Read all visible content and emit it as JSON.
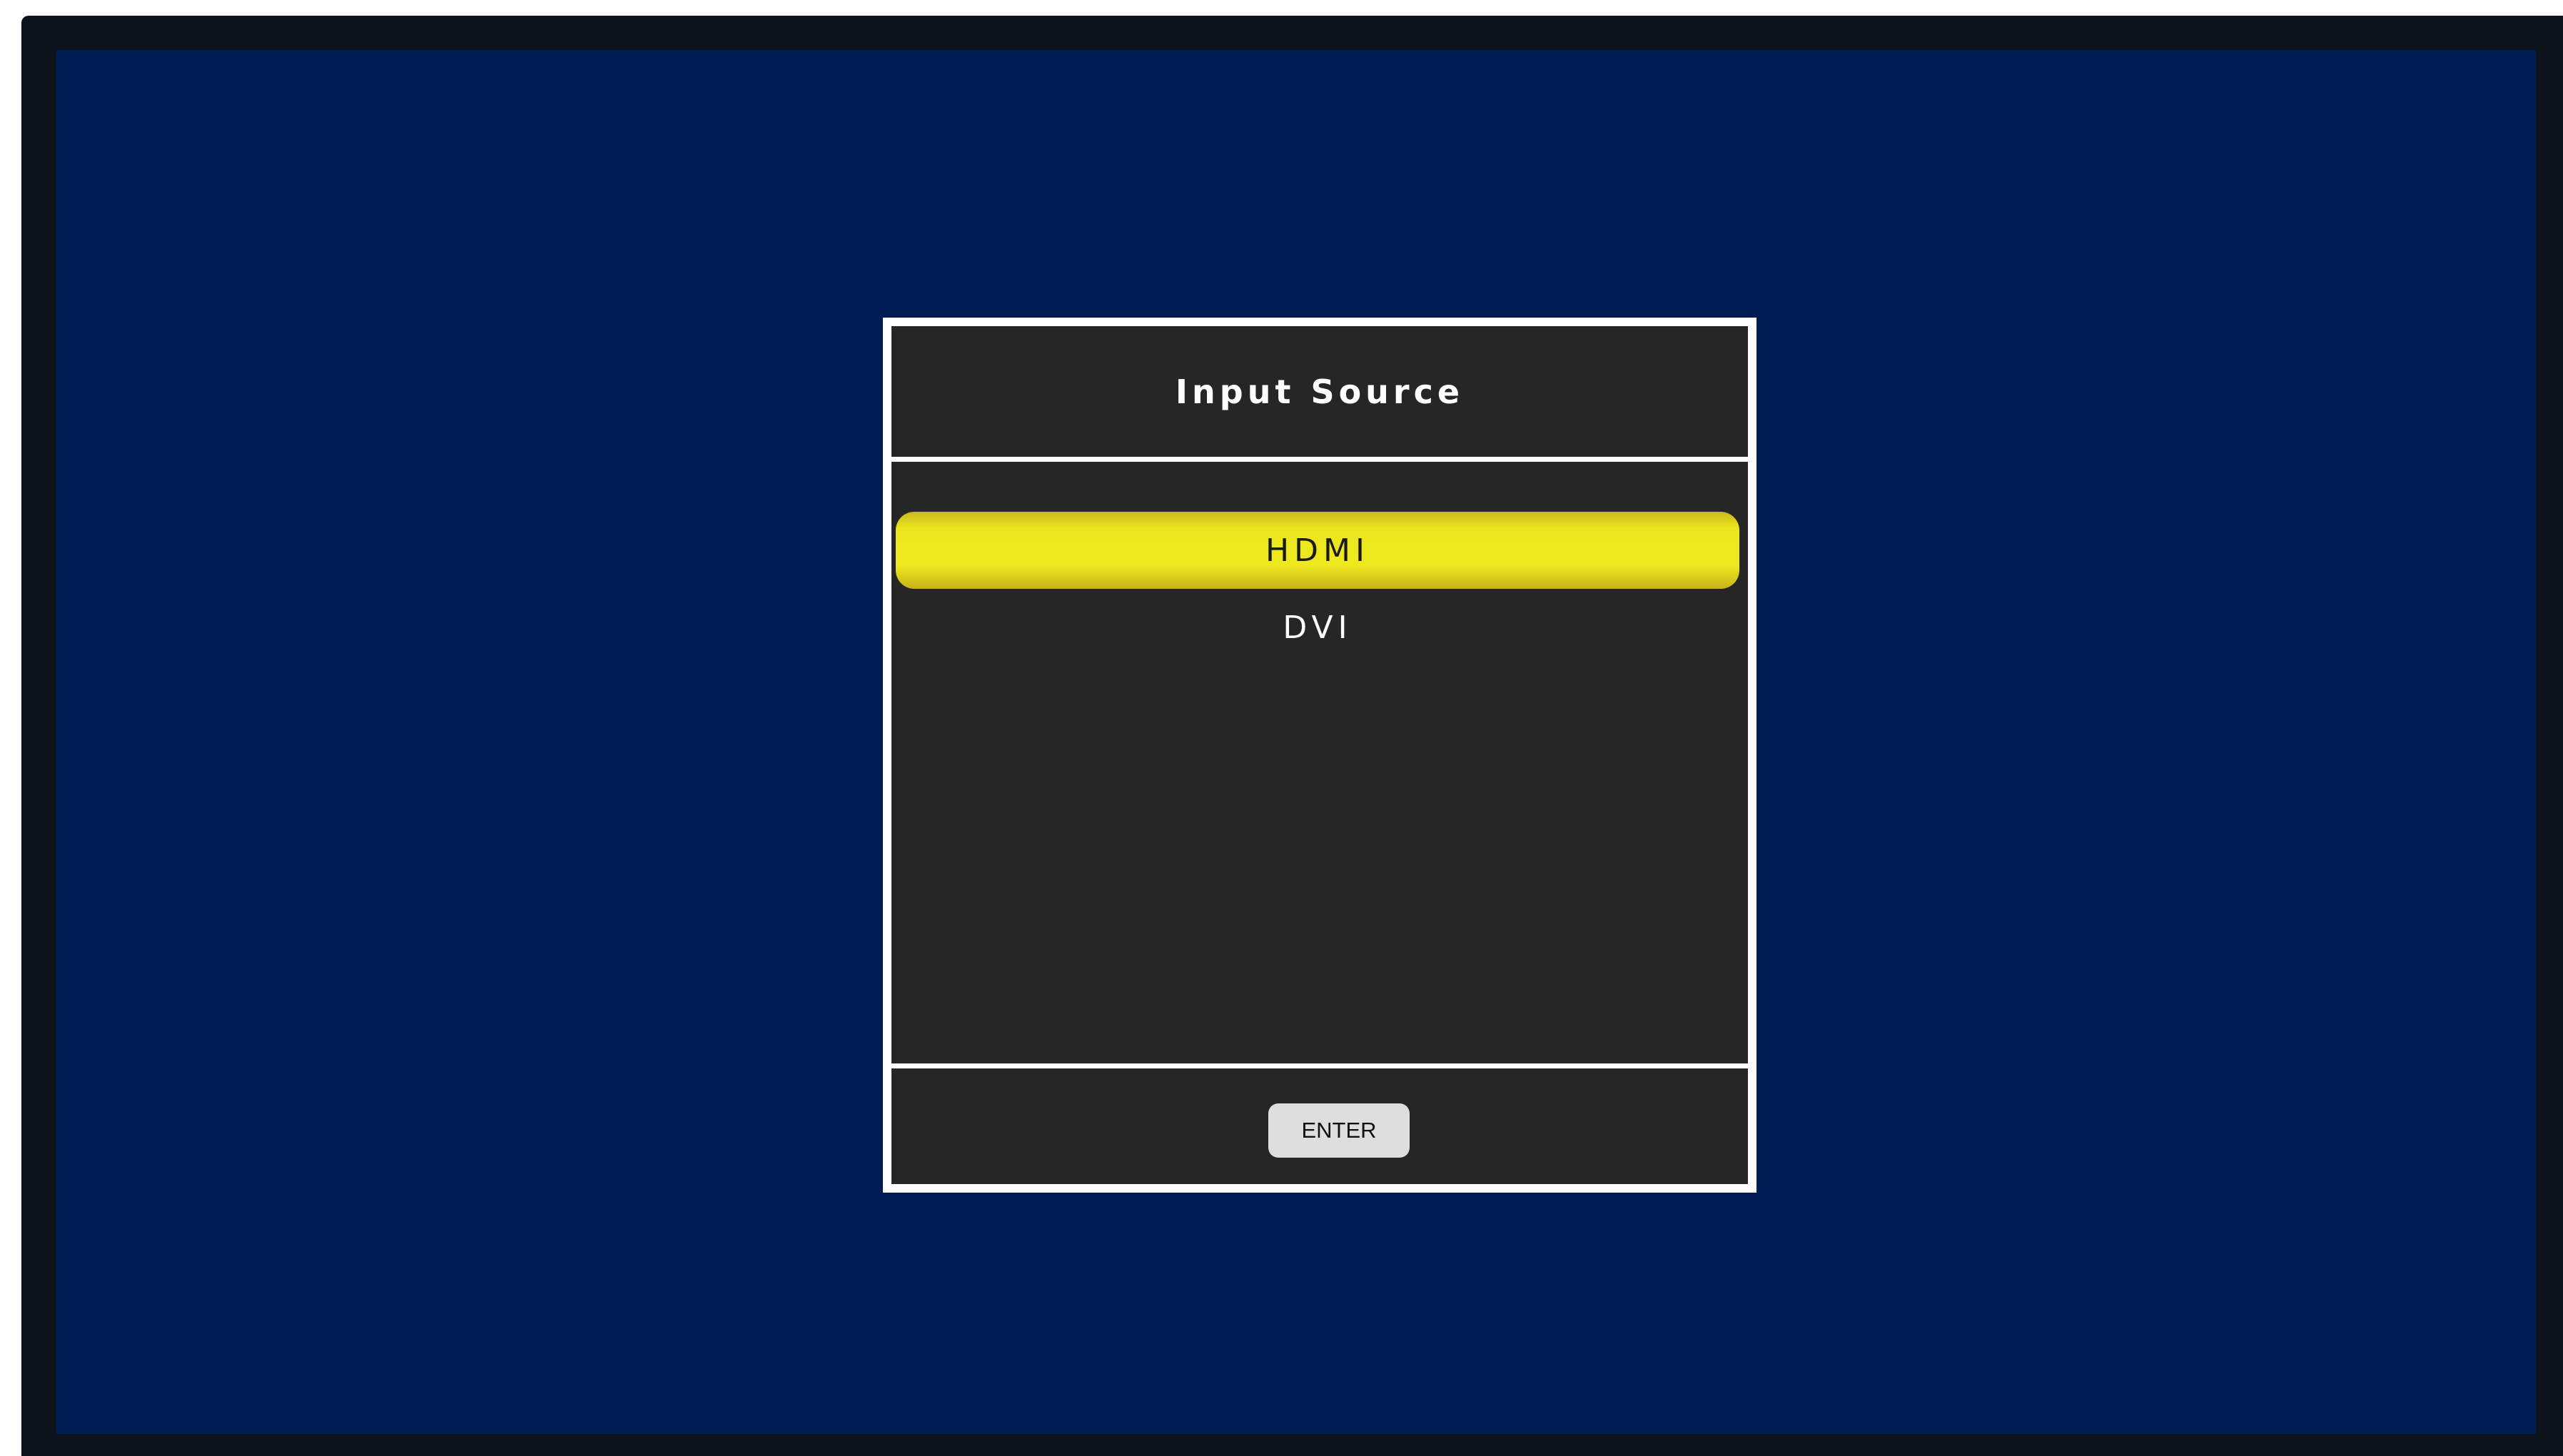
{
  "dialog": {
    "title": "Input Source",
    "sources": [
      {
        "label": "HDMI",
        "selected": true
      },
      {
        "label": "DVI",
        "selected": false
      }
    ],
    "enter_label": "ENTER"
  },
  "colors": {
    "screen_background": "#001c54",
    "bezel": "#0c131c",
    "dialog_panel": "#262626",
    "dialog_border": "#ffffff",
    "selection_highlight": "#ece61e",
    "button": "#dedede"
  }
}
